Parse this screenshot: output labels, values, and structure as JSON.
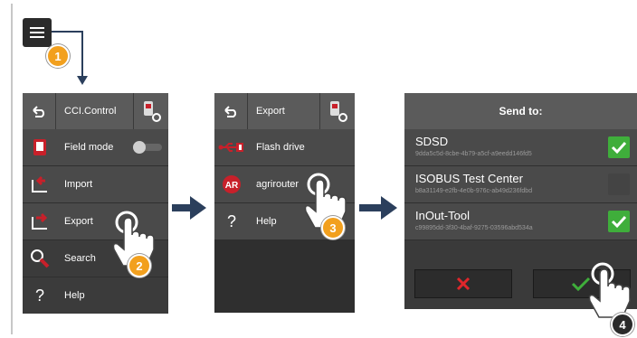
{
  "steps": [
    "1",
    "2",
    "3",
    "4"
  ],
  "menu_panel": {
    "title": "CCI.Control",
    "items": [
      {
        "label": "Field mode",
        "icon": "field-mode-icon"
      },
      {
        "label": "Import",
        "icon": "import-icon"
      },
      {
        "label": "Export",
        "icon": "export-icon"
      },
      {
        "label": "Search",
        "icon": "search-icon"
      },
      {
        "label": "Help",
        "icon": "help-icon"
      }
    ],
    "field_mode_toggle": "off"
  },
  "export_panel": {
    "title": "Export",
    "items": [
      {
        "label": "Flash drive",
        "icon": "usb-icon"
      },
      {
        "label": "agrirouter",
        "icon": "agrirouter-logo"
      },
      {
        "label": "Help",
        "icon": "help-icon"
      }
    ]
  },
  "send_panel": {
    "title": "Send to:",
    "targets": [
      {
        "name": "SDSD",
        "id": "9dda5c5d-8cbe-4b79-a5cf-a9eedd146fd5",
        "checked": true
      },
      {
        "name": "ISOBUS Test Center",
        "id": "b8a31149-e2fb-4e0b-976c-ab49d236fdbd",
        "checked": false
      },
      {
        "name": "InOut-Tool",
        "id": "c99895dd-3f30-4baf-9275-03596abd534a",
        "checked": true
      }
    ],
    "cancel_icon": "x-icon",
    "confirm_icon": "checkmark-icon"
  },
  "colors": {
    "accent": "#f2a01e",
    "check": "#3fae3b",
    "cancel": "#e0262b",
    "brand_red": "#c8202a"
  }
}
